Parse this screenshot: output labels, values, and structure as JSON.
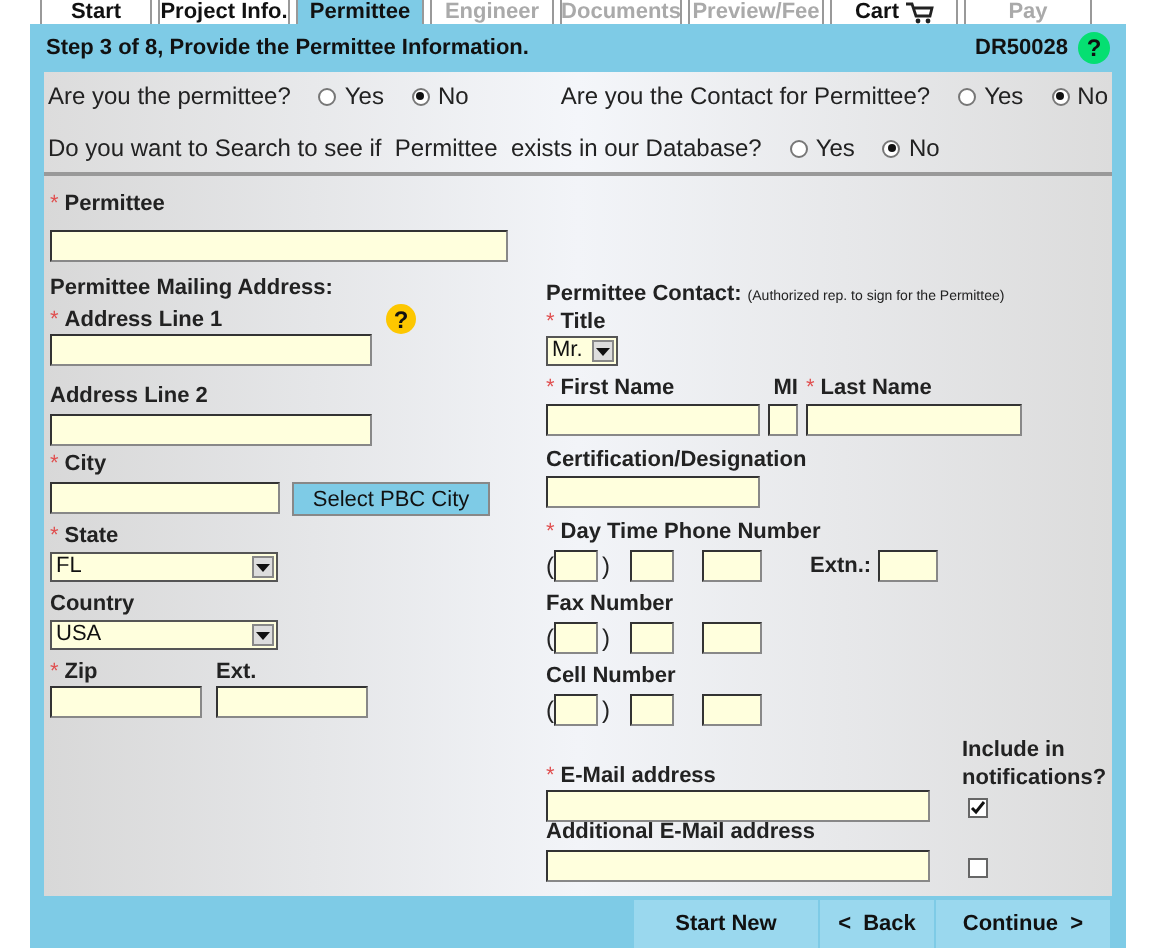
{
  "required_mark": "*",
  "tabs": [
    {
      "kind": "text",
      "label": "Start",
      "selected": false,
      "disabled": false
    },
    {
      "kind": "text",
      "label": "Project Info.",
      "selected": false,
      "disabled": false
    },
    {
      "kind": "text",
      "label": "Permittee",
      "selected": true,
      "disabled": false
    },
    {
      "kind": "text",
      "label": "Engineer",
      "selected": false,
      "disabled": true
    },
    {
      "kind": "text",
      "label": "Documents",
      "selected": false,
      "disabled": true
    },
    {
      "kind": "text",
      "label": "Preview/Fee",
      "selected": false,
      "disabled": true
    },
    {
      "kind": "cart",
      "label": "Cart",
      "selected": false,
      "disabled": false
    },
    {
      "kind": "text",
      "label": "Pay",
      "selected": false,
      "disabled": true
    }
  ],
  "header": {
    "title": "Step 3 of 8, Provide the Permittee Information.",
    "code": "DR50028",
    "help": "?"
  },
  "questions": [
    {
      "label": "Are you the permittee?",
      "options": [
        {
          "label": "Yes",
          "selected": false
        },
        {
          "label": "No",
          "selected": true
        }
      ]
    },
    {
      "label": "Are you the Contact for Permittee?",
      "options": [
        {
          "label": "Yes",
          "selected": false
        },
        {
          "label": "No",
          "selected": true
        }
      ]
    },
    {
      "label": "Do you want to Search to see if  Permittee  exists in our Database?",
      "options": [
        {
          "label": "Yes",
          "selected": false
        },
        {
          "label": "No",
          "selected": true
        }
      ]
    }
  ],
  "permittee": {
    "label": "Permittee",
    "required": true
  },
  "mailing": {
    "heading": "Permittee Mailing Address:",
    "address1": {
      "label": "Address Line 1",
      "required": true,
      "help": "?"
    },
    "address2": {
      "label": "Address Line 2",
      "required": false
    },
    "city": {
      "label": "City",
      "required": true,
      "button": "Select PBC City"
    },
    "state": {
      "label": "State",
      "required": true,
      "value": "FL"
    },
    "country": {
      "label": "Country",
      "required": false,
      "value": "USA"
    },
    "zip": {
      "label": "Zip",
      "required": true
    },
    "ext": {
      "label": "Ext.",
      "required": false
    }
  },
  "contact": {
    "heading": "Permittee Contact:",
    "note": "(Authorized rep. to sign for the Permittee)",
    "title": {
      "label": "Title",
      "required": true,
      "value": "Mr."
    },
    "first_name": {
      "label": "First Name",
      "required": true
    },
    "mi": {
      "label": "MI",
      "required": false
    },
    "last_name": {
      "label": "Last Name",
      "required": true
    },
    "certification": {
      "label": "Certification/Designation",
      "required": false
    },
    "phones": [
      {
        "label": "Day Time Phone Number",
        "required": true,
        "open": "(",
        "close": ")",
        "extension": "Extn.:"
      },
      {
        "label": "Fax Number",
        "required": false,
        "open": "(",
        "close": ")"
      },
      {
        "label": "Cell Number",
        "required": false,
        "open": "(",
        "close": ")"
      }
    ],
    "include_heading": "Include in notifications?",
    "emails": [
      {
        "label": "E-Mail address",
        "required": true,
        "checked": true
      },
      {
        "label": "Additional E-Mail address",
        "required": false,
        "checked": false
      }
    ]
  },
  "buttons": [
    "Start New",
    "<  Back",
    "Continue  >"
  ]
}
